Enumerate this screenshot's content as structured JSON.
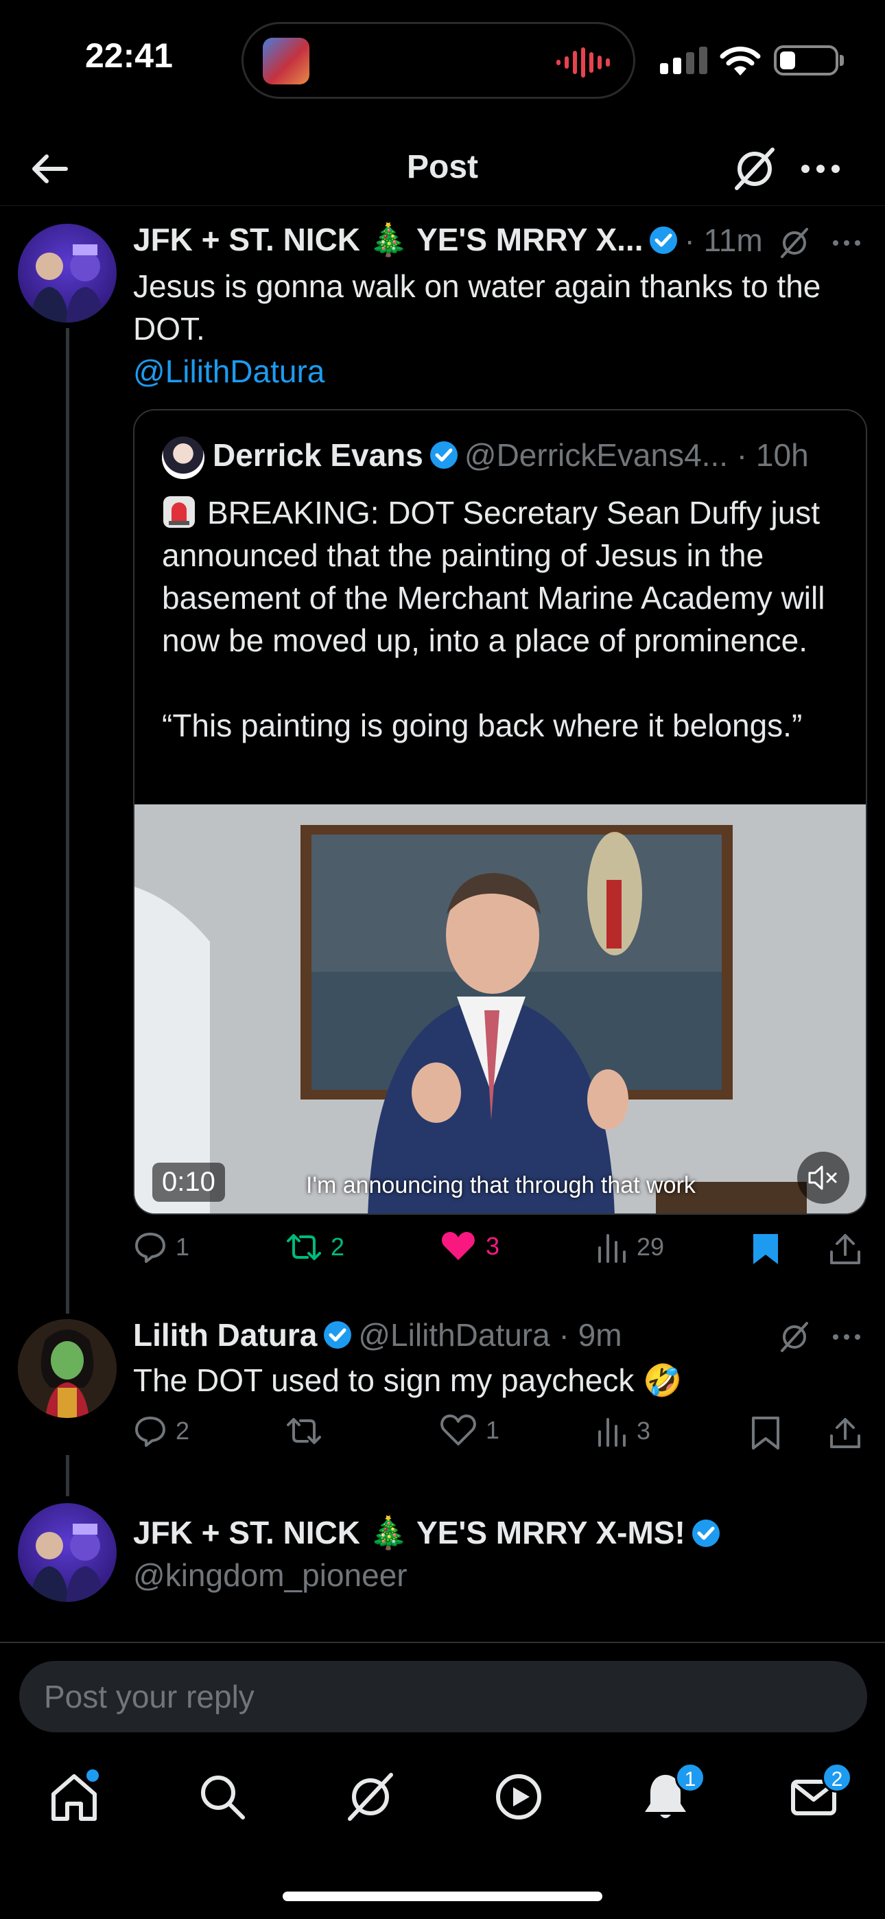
{
  "status_bar": {
    "time": "22:41"
  },
  "header": {
    "title": "Post"
  },
  "tweet1": {
    "name": "JFK + ST. NICK 🎄 YE'S MRRY X...",
    "time": "11m",
    "text": "Jesus is gonna walk on water again thanks to the DOT.",
    "mention": "@LilithDatura",
    "actions": {
      "replies": "1",
      "reposts": "2",
      "likes": "3",
      "views": "29"
    }
  },
  "quote": {
    "name": "Derrick Evans",
    "handle": "@DerrickEvans4...",
    "time": "10h",
    "text": "BREAKING: DOT Secretary Sean Duffy just announced that the painting of Jesus in the basement of the Merchant Marine Academy will now be moved up, into a place of prominence.",
    "quote_line": "“This painting is going back where it belongs.”",
    "video": {
      "duration": "0:10",
      "caption": "I'm announcing that through that work"
    }
  },
  "tweet2": {
    "name": "Lilith Datura",
    "handle": "@LilithDatura",
    "time": "9m",
    "text": "The DOT used to sign my paycheck 🤣",
    "actions": {
      "replies": "2",
      "likes": "1",
      "views": "3"
    }
  },
  "composer_user": {
    "name": "JFK + ST. NICK 🎄 YE'S MRRY X-MS!",
    "handle": "@kingdom_pioneer"
  },
  "reply": {
    "placeholder": "Post your reply"
  },
  "tabbar": {
    "notifications_badge": "1",
    "messages_badge": "2"
  },
  "colors": {
    "accent": "#1d9bf0",
    "like": "#f91880",
    "repost": "#00ba7c",
    "muted": "#71767b"
  }
}
